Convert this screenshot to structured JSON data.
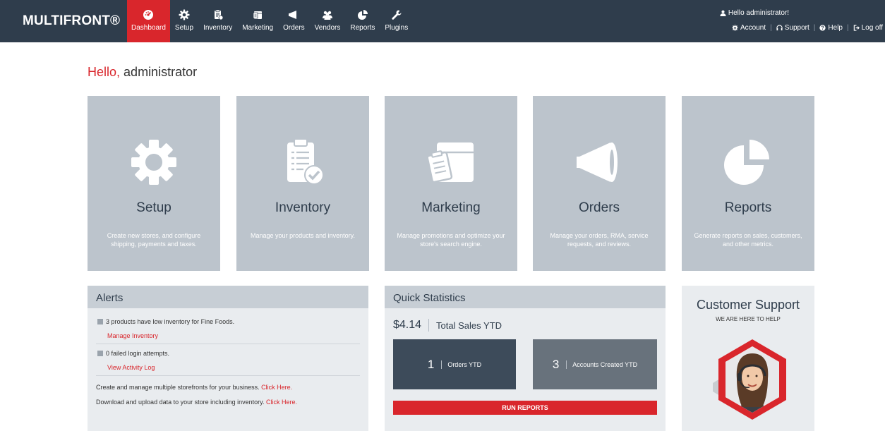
{
  "brand": "MULTIFRONT®",
  "nav": [
    {
      "label": "Dashboard",
      "icon": "dashboard-icon",
      "active": true
    },
    {
      "label": "Setup",
      "icon": "gear-icon"
    },
    {
      "label": "Inventory",
      "icon": "clipboard-icon"
    },
    {
      "label": "Marketing",
      "icon": "box-icon"
    },
    {
      "label": "Orders",
      "icon": "megaphone-icon"
    },
    {
      "label": "Vendors",
      "icon": "users-icon"
    },
    {
      "label": "Reports",
      "icon": "pie-chart-icon"
    },
    {
      "label": "Plugins",
      "icon": "wrench-icon"
    }
  ],
  "user": {
    "greeting": "Hello administrator!",
    "account": "Account",
    "support": "Support",
    "help": "Help",
    "logoff": "Log off"
  },
  "greeting": {
    "hello": "Hello,",
    "name": "administrator"
  },
  "tiles": [
    {
      "title": "Setup",
      "desc": "Create new stores, and configure shipping, payments and taxes.",
      "icon": "gear-icon"
    },
    {
      "title": "Inventory",
      "desc": "Manage your products and inventory.",
      "icon": "clipboard-check-icon"
    },
    {
      "title": "Marketing",
      "desc": "Manage promotions and optimize your store's search engine.",
      "icon": "box-clipboard-icon"
    },
    {
      "title": "Orders",
      "desc": "Manage your orders, RMA, service requests, and reviews.",
      "icon": "megaphone-icon"
    },
    {
      "title": "Reports",
      "desc": "Generate reports on sales, customers, and other metrics.",
      "icon": "pie-chart-icon"
    }
  ],
  "alerts": {
    "title": "Alerts",
    "items": [
      {
        "text": "3 products have low inventory for Fine Foods.",
        "link": "Manage Inventory"
      },
      {
        "text": "0 failed login attempts.",
        "link": "View Activity Log"
      }
    ],
    "line1": "Create and manage multiple storefronts for your business.",
    "line1_link": "Click Here.",
    "line2": "Download and upload data to your store including inventory.",
    "line2_link": "Click Here."
  },
  "quick_stats": {
    "title": "Quick Statistics",
    "total_amount": "$4.14",
    "total_label": "Total Sales YTD",
    "orders_value": "1",
    "orders_label": "Orders YTD",
    "accounts_value": "3",
    "accounts_label": "Accounts Created YTD",
    "run_reports": "RUN REPORTS"
  },
  "support": {
    "title": "Customer Support",
    "subtitle": "WE ARE HERE TO HELP"
  },
  "colors": {
    "navbar": "#2f3d4c",
    "accent": "#d9262c",
    "tile": "#bcc4cc"
  }
}
